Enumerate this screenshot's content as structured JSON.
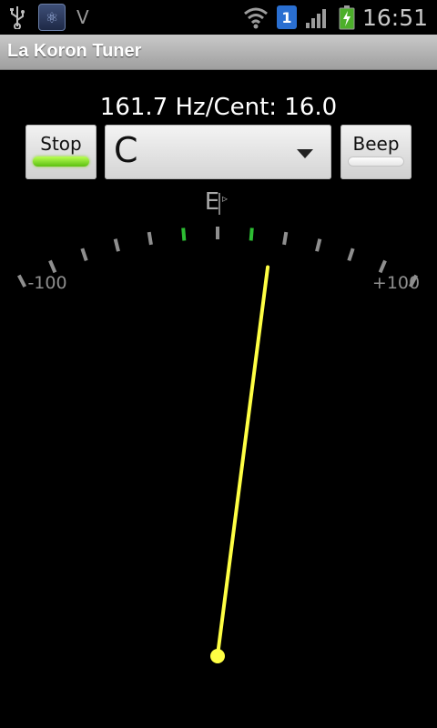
{
  "status_bar": {
    "time": "16:51",
    "carrier_mark": "V",
    "sim_number": "1",
    "icons": [
      "usb-icon",
      "app-notification-icon",
      "wifi-icon",
      "sim-icon",
      "signal-icon",
      "battery-charging-icon"
    ]
  },
  "app": {
    "title": "La Koron Tuner"
  },
  "readout": {
    "text": "161.7 Hz/Cent: 16.0"
  },
  "controls": {
    "stop_label": "Stop",
    "stop_active": true,
    "note_selected": "C",
    "beep_label": "Beep",
    "beep_active": false
  },
  "meter": {
    "note": "E",
    "min_label": "-100",
    "max_label": "+100",
    "cents": 16.0,
    "tick_count": 21,
    "highlighted_ticks": [
      9,
      11
    ],
    "colors": {
      "tick": "#8f8f8f",
      "tick_active": "#2dbd33",
      "needle": "#ffff44"
    }
  }
}
